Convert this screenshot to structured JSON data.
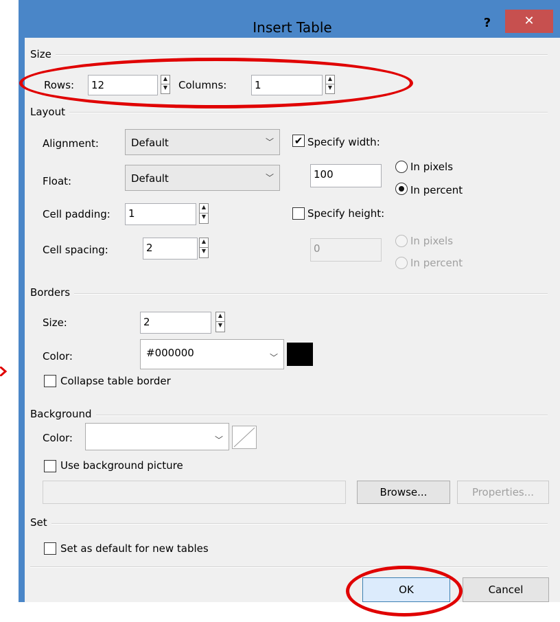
{
  "dialog": {
    "title": "Insert Table",
    "help_label": "?",
    "close_label": "✕"
  },
  "size": {
    "group": "Size",
    "rows_label": "Rows:",
    "rows_value": "12",
    "columns_label": "Columns:",
    "columns_value": "1"
  },
  "layout": {
    "group": "Layout",
    "alignment_label": "Alignment:",
    "alignment_value": "Default",
    "float_label": "Float:",
    "float_value": "Default",
    "cell_padding_label": "Cell padding:",
    "cell_padding_value": "1",
    "cell_spacing_label": "Cell spacing:",
    "cell_spacing_value": "2",
    "specify_width_label": "Specify width:",
    "specify_width_checked": true,
    "width_value": "100",
    "in_pixels_label": "In pixels",
    "in_percent_label": "In percent",
    "width_unit_selected": "In percent",
    "specify_height_label": "Specify height:",
    "specify_height_checked": false,
    "height_value": "0",
    "height_in_pixels_label": "In pixels",
    "height_in_percent_label": "In percent"
  },
  "borders": {
    "group": "Borders",
    "size_label": "Size:",
    "size_value": "2",
    "color_label": "Color:",
    "color_value": "#000000",
    "collapse_label": "Collapse table border",
    "collapse_checked": false
  },
  "background": {
    "group": "Background",
    "color_label": "Color:",
    "color_value": "",
    "use_picture_label": "Use background picture",
    "use_picture_checked": false,
    "picture_path": "",
    "browse_label": "Browse...",
    "properties_label": "Properties..."
  },
  "set": {
    "group": "Set",
    "default_label": "Set as default for new tables",
    "default_checked": false
  },
  "buttons": {
    "ok_label": "OK",
    "cancel_label": "Cancel"
  },
  "colors": {
    "title_bar": "#4a86c8",
    "close_button": "#c7504f",
    "annotation": "#e00000",
    "border_swatch": "#000000"
  }
}
